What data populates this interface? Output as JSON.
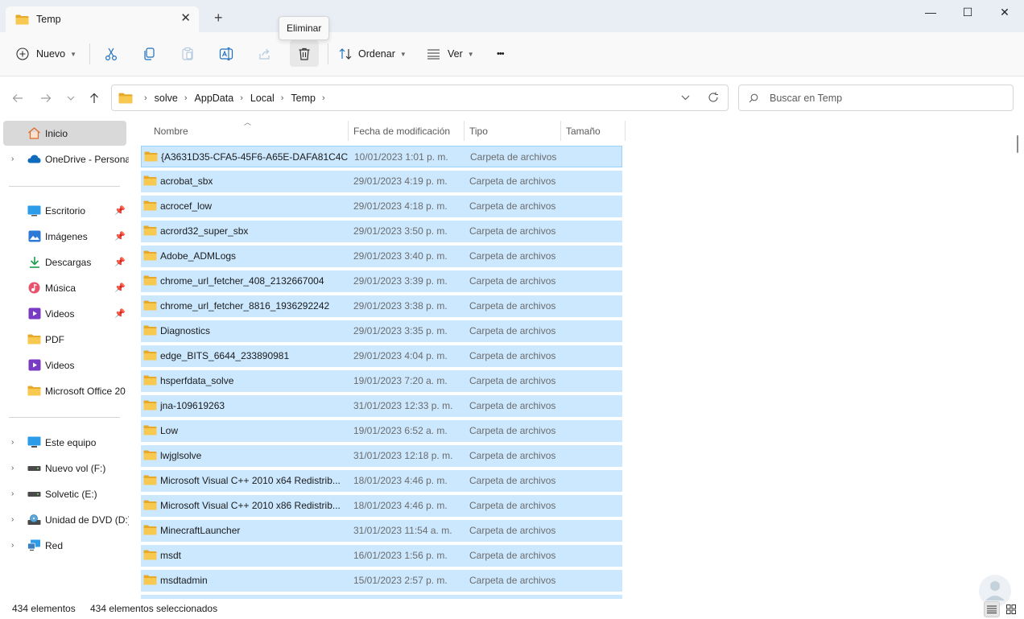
{
  "window": {
    "tab_title": "Temp",
    "tab_close": "✕",
    "new_tab": "+",
    "minimize": "—",
    "maximize": "☐",
    "close": "✕"
  },
  "toolbar": {
    "new_label": "Nuevo",
    "sort_label": "Ordenar",
    "view_label": "Ver",
    "more_label": "•••",
    "tooltip": "Eliminar",
    "icons": [
      "cut-icon",
      "copy-icon",
      "paste-icon",
      "rename-icon",
      "share-icon",
      "delete-icon"
    ]
  },
  "address": {
    "breadcrumbs": [
      "solve",
      "AppData",
      "Local",
      "Temp"
    ],
    "search_placeholder": "Buscar en Temp"
  },
  "sidebar": {
    "items": [
      {
        "label": "Inicio",
        "icon": "home-icon",
        "active": true
      },
      {
        "label": "OneDrive - Persona",
        "icon": "onedrive-icon",
        "expandable": true
      },
      {
        "label": "Escritorio",
        "icon": "desktop-icon",
        "pinned": true
      },
      {
        "label": "Imágenes",
        "icon": "pictures-icon",
        "pinned": true
      },
      {
        "label": "Descargas",
        "icon": "downloads-icon",
        "pinned": true
      },
      {
        "label": "Música",
        "icon": "music-icon",
        "pinned": true
      },
      {
        "label": "Videos",
        "icon": "videos-icon",
        "pinned": true
      },
      {
        "label": "PDF",
        "icon": "folder-icon"
      },
      {
        "label": "Videos",
        "icon": "videos-icon"
      },
      {
        "label": "Microsoft Office 20",
        "icon": "folder-icon"
      },
      {
        "label": "Este equipo",
        "icon": "this-pc-icon",
        "expandable": true
      },
      {
        "label": "Nuevo vol (F:)",
        "icon": "drive-icon",
        "expandable": true
      },
      {
        "label": "Solvetic (E:)",
        "icon": "drive-icon",
        "expandable": true
      },
      {
        "label": "Unidad de DVD (D:)",
        "icon": "dvd-icon",
        "expandable": true
      },
      {
        "label": "Red",
        "icon": "network-icon",
        "expandable": true
      }
    ]
  },
  "columns": {
    "name": "Nombre",
    "date": "Fecha de modificación",
    "type": "Tipo",
    "size": "Tamaño"
  },
  "files": [
    {
      "name": "{A3631D35-CFA5-45F6-A65E-DAFA81C4C...",
      "date": "10/01/2023 1:01 p. m.",
      "type": "Carpeta de archivos"
    },
    {
      "name": "acrobat_sbx",
      "date": "29/01/2023 4:19 p. m.",
      "type": "Carpeta de archivos"
    },
    {
      "name": "acrocef_low",
      "date": "29/01/2023 4:18 p. m.",
      "type": "Carpeta de archivos"
    },
    {
      "name": "acrord32_super_sbx",
      "date": "29/01/2023 3:50 p. m.",
      "type": "Carpeta de archivos"
    },
    {
      "name": "Adobe_ADMLogs",
      "date": "29/01/2023 3:40 p. m.",
      "type": "Carpeta de archivos"
    },
    {
      "name": "chrome_url_fetcher_408_2132667004",
      "date": "29/01/2023 3:39 p. m.",
      "type": "Carpeta de archivos"
    },
    {
      "name": "chrome_url_fetcher_8816_1936292242",
      "date": "29/01/2023 3:38 p. m.",
      "type": "Carpeta de archivos"
    },
    {
      "name": "Diagnostics",
      "date": "29/01/2023 3:35 p. m.",
      "type": "Carpeta de archivos"
    },
    {
      "name": "edge_BITS_6644_233890981",
      "date": "29/01/2023 4:04 p. m.",
      "type": "Carpeta de archivos"
    },
    {
      "name": "hsperfdata_solve",
      "date": "19/01/2023 7:20 a. m.",
      "type": "Carpeta de archivos"
    },
    {
      "name": "jna-109619263",
      "date": "31/01/2023 12:33 p. m.",
      "type": "Carpeta de archivos"
    },
    {
      "name": "Low",
      "date": "19/01/2023 6:52 a. m.",
      "type": "Carpeta de archivos"
    },
    {
      "name": "lwjglsolve",
      "date": "31/01/2023 12:18 p. m.",
      "type": "Carpeta de archivos"
    },
    {
      "name": "Microsoft Visual C++ 2010  x64 Redistrib...",
      "date": "18/01/2023 4:46 p. m.",
      "type": "Carpeta de archivos"
    },
    {
      "name": "Microsoft Visual C++ 2010  x86 Redistrib...",
      "date": "18/01/2023 4:46 p. m.",
      "type": "Carpeta de archivos"
    },
    {
      "name": "MinecraftLauncher",
      "date": "31/01/2023 11:54 a. m.",
      "type": "Carpeta de archivos"
    },
    {
      "name": "msdt",
      "date": "16/01/2023 1:56 p. m.",
      "type": "Carpeta de archivos"
    },
    {
      "name": "msdtadmin",
      "date": "15/01/2023 2:57 p. m.",
      "type": "Carpeta de archivos"
    },
    {
      "name": "",
      "date": "",
      "type": ""
    }
  ],
  "status": {
    "count": "434 elementos",
    "selected": "434 elementos seleccionados"
  },
  "colors": {
    "selection": "#cce8ff",
    "selection_border": "#99d1ff",
    "folder": "#f8c950",
    "titlebar": "#e9eef5"
  }
}
